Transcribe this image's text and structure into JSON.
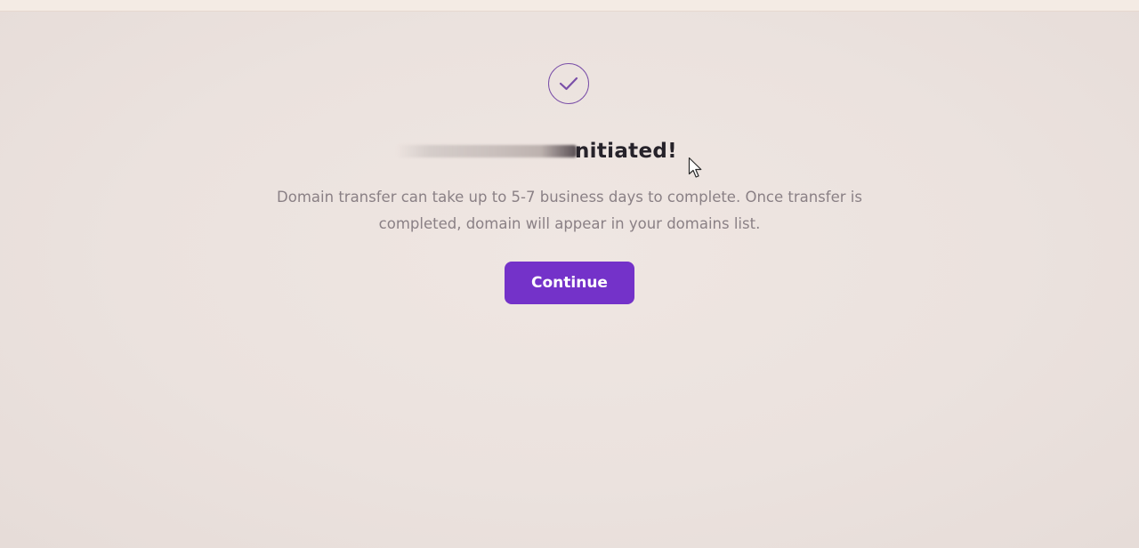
{
  "dialog": {
    "icon": "check-circle-icon",
    "title": "nitiated!",
    "description": "Domain transfer can take up to 5-7 business days to complete. Once transfer is completed, domain will appear in your domains list.",
    "continue_label": "Continue"
  },
  "colors": {
    "accent": "#7432c9",
    "icon_stroke": "#7a4fa8",
    "background": "#ece3df",
    "title": "#26222a",
    "description": "#8a8085"
  },
  "cursor": {
    "icon": "mouse-pointer-icon"
  }
}
